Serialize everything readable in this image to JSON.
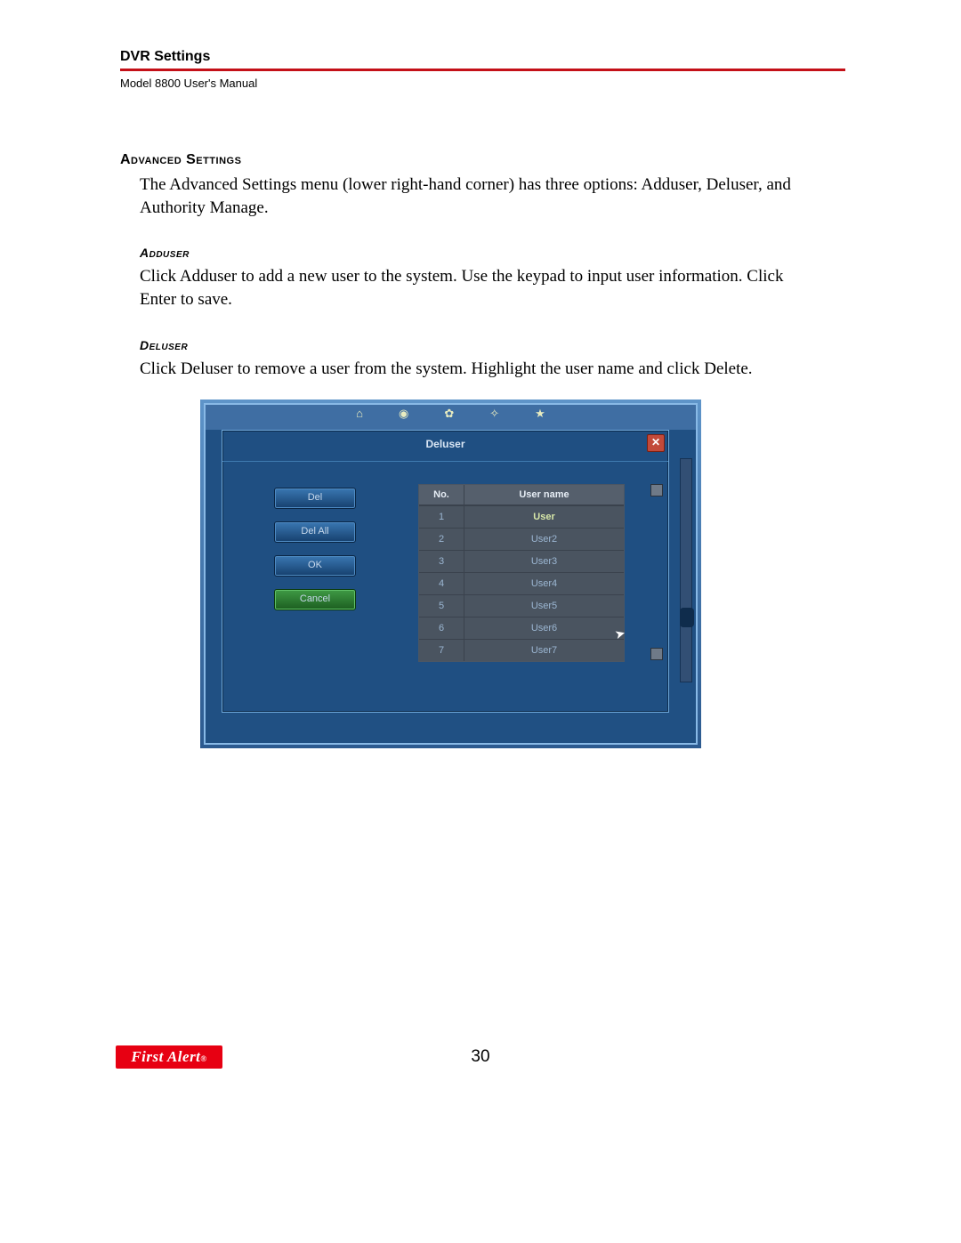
{
  "header": {
    "title": "DVR Settings",
    "subtitle": "Model 8800 User's Manual"
  },
  "section_advanced": {
    "heading": "Advanced Settings",
    "paragraph": "The Advanced Settings menu (lower right-hand corner) has three options: Adduser, Deluser, and Authority Manage."
  },
  "section_adduser": {
    "heading": "Adduser",
    "paragraph": "Click Adduser to add a new user to the system. Use the keypad to input user information. Click Enter to save."
  },
  "section_deluser": {
    "heading": "Deluser",
    "paragraph": "Click Deluser to remove a user from the system. Highlight the user name and click Delete."
  },
  "screenshot": {
    "modal_title": "Deluser",
    "close_glyph": "✕",
    "buttons": {
      "del": "Del",
      "del_all": "Del All",
      "ok": "OK",
      "cancel": "Cancel"
    },
    "table": {
      "col_no": "No.",
      "col_name": "User name",
      "rows": [
        {
          "no": "1",
          "name": "User",
          "selected": true
        },
        {
          "no": "2",
          "name": "User2",
          "selected": false
        },
        {
          "no": "3",
          "name": "User3",
          "selected": false
        },
        {
          "no": "4",
          "name": "User4",
          "selected": false
        },
        {
          "no": "5",
          "name": "User5",
          "selected": false
        },
        {
          "no": "6",
          "name": "User6",
          "selected": false
        },
        {
          "no": "7",
          "name": "User7",
          "selected": false
        }
      ]
    },
    "cursor_glyph": "➤"
  },
  "footer": {
    "logo_text": "First Alert",
    "page_number": "30"
  }
}
